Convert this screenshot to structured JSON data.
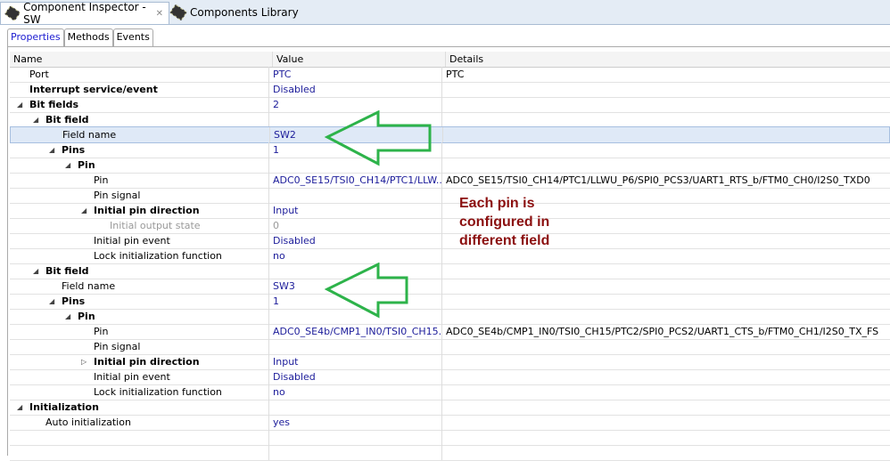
{
  "tabs": [
    {
      "label": "Component Inspector - SW",
      "icon": "chip-icon"
    },
    {
      "label": "Components Library",
      "icon": "chip-icon"
    }
  ],
  "subtabs": [
    "Properties",
    "Methods",
    "Events"
  ],
  "columns": [
    "Name",
    "Value",
    "Details"
  ],
  "rows": [
    {
      "name": "Port",
      "value": "PTC",
      "details": "PTC",
      "level": 1,
      "bold": false,
      "exp": ""
    },
    {
      "name": "Interrupt service/event",
      "value": "Disabled",
      "details": "",
      "level": 1,
      "bold": true,
      "exp": ""
    },
    {
      "name": "Bit fields",
      "value": "2",
      "details": "",
      "level": 1,
      "bold": true,
      "exp": "open"
    },
    {
      "name": "Bit field",
      "value": "",
      "details": "",
      "level": 2,
      "bold": true,
      "exp": "open"
    },
    {
      "name": "Field name",
      "value": "SW2",
      "details": "",
      "level": 3,
      "bold": false,
      "exp": "",
      "selected": true
    },
    {
      "name": "Pins",
      "value": "1",
      "details": "",
      "level": 3,
      "bold": true,
      "exp": "open"
    },
    {
      "name": "Pin",
      "value": "",
      "details": "",
      "level": 4,
      "bold": true,
      "exp": "open"
    },
    {
      "name": "Pin",
      "value": "ADC0_SE15/TSI0_CH14/PTC1/LLW...",
      "details": "ADC0_SE15/TSI0_CH14/PTC1/LLWU_P6/SPI0_PCS3/UART1_RTS_b/FTM0_CH0/I2S0_TXD0",
      "level": 5,
      "bold": false,
      "exp": ""
    },
    {
      "name": "Pin signal",
      "value": "",
      "details": "",
      "level": 5,
      "bold": false,
      "exp": ""
    },
    {
      "name": "Initial pin direction",
      "value": "Input",
      "details": "",
      "level": 5,
      "bold": true,
      "exp": "open"
    },
    {
      "name": "Initial output state",
      "value": "0",
      "details": "",
      "level": 6,
      "bold": false,
      "exp": "",
      "gray": true
    },
    {
      "name": "Initial pin event",
      "value": "Disabled",
      "details": "",
      "level": 5,
      "bold": false,
      "exp": ""
    },
    {
      "name": "Lock initialization function",
      "value": "no",
      "details": "",
      "level": 5,
      "bold": false,
      "exp": ""
    },
    {
      "name": "Bit field",
      "value": "",
      "details": "",
      "level": 2,
      "bold": true,
      "exp": "open"
    },
    {
      "name": "Field name",
      "value": "SW3",
      "details": "",
      "level": 3,
      "bold": false,
      "exp": ""
    },
    {
      "name": "Pins",
      "value": "1",
      "details": "",
      "level": 3,
      "bold": true,
      "exp": "open"
    },
    {
      "name": "Pin",
      "value": "",
      "details": "",
      "level": 4,
      "bold": true,
      "exp": "open"
    },
    {
      "name": "Pin",
      "value": "ADC0_SE4b/CMP1_IN0/TSI0_CH15...",
      "details": "ADC0_SE4b/CMP1_IN0/TSI0_CH15/PTC2/SPI0_PCS2/UART1_CTS_b/FTM0_CH1/I2S0_TX_FS",
      "level": 5,
      "bold": false,
      "exp": ""
    },
    {
      "name": "Pin signal",
      "value": "",
      "details": "",
      "level": 5,
      "bold": false,
      "exp": ""
    },
    {
      "name": "Initial pin direction",
      "value": "Input",
      "details": "",
      "level": 5,
      "bold": true,
      "exp": "closed"
    },
    {
      "name": "Initial pin event",
      "value": "Disabled",
      "details": "",
      "level": 5,
      "bold": false,
      "exp": ""
    },
    {
      "name": "Lock initialization function",
      "value": "no",
      "details": "",
      "level": 5,
      "bold": false,
      "exp": ""
    },
    {
      "name": "Initialization",
      "value": "",
      "details": "",
      "level": 1,
      "bold": true,
      "exp": "open"
    },
    {
      "name": "Auto initialization",
      "value": "yes",
      "details": "",
      "level": 2,
      "bold": false,
      "exp": ""
    }
  ],
  "annotation": {
    "lines": [
      "Each pin is",
      "configured in",
      "different field"
    ],
    "color": "#8b0f0f",
    "arrow_color": "#2db34a"
  }
}
